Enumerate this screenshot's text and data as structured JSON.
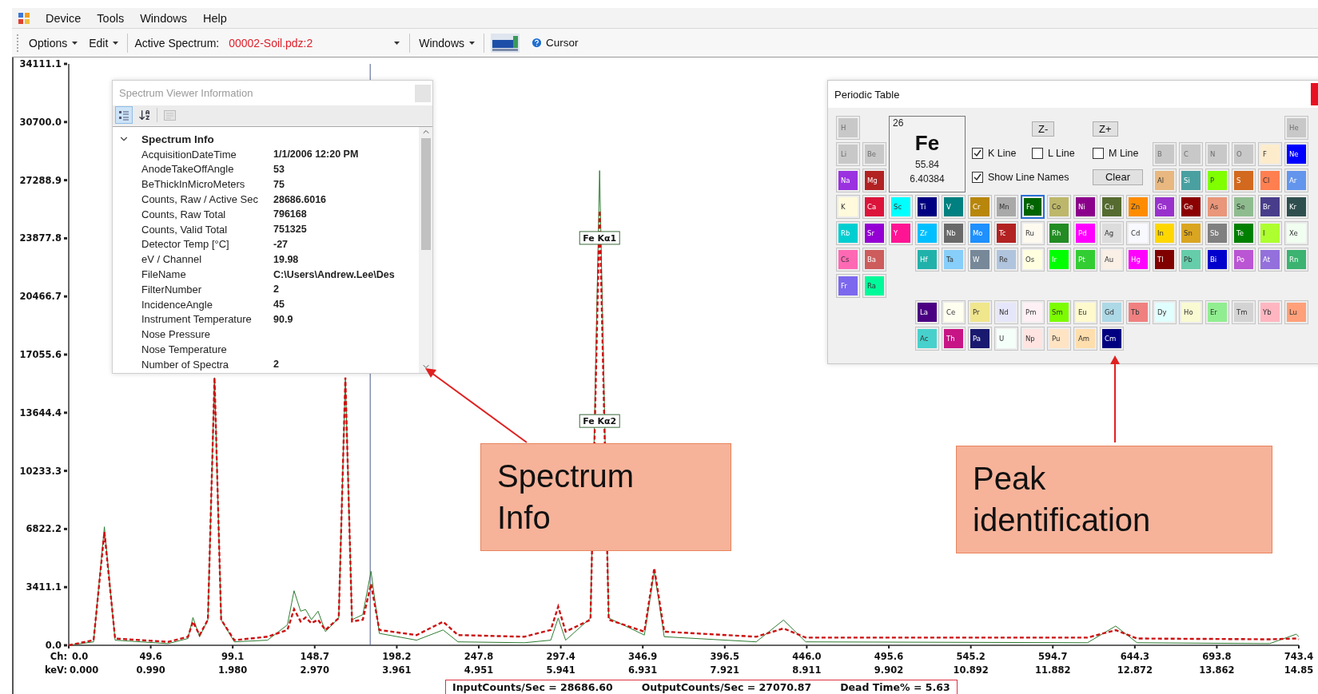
{
  "menu": [
    "Device",
    "Tools",
    "Windows",
    "Help"
  ],
  "toolbar": {
    "menus": [
      "Options",
      "Edit"
    ],
    "active_spectrum": {
      "label": "Active Spectrum:",
      "value": "00002-Soil.pdz:2"
    },
    "windows_menu": "Windows",
    "cursor_button": "Cursor"
  },
  "chart": {
    "channel_axis": {
      "label": "Ch:",
      "ticks": [
        "0.0",
        "49.6",
        "99.1",
        "148.7",
        "198.2",
        "247.8",
        "297.4",
        "346.9",
        "396.5",
        "446.0",
        "495.6",
        "545.2",
        "594.7",
        "644.3",
        "693.8",
        "743.4"
      ]
    },
    "chart_data": {
      "type": "line",
      "xlabel": "keV:",
      "xlim": [
        0,
        14.852
      ],
      "ylim": [
        0,
        34111.1
      ],
      "ref_lines": [
        {
          "axis": "x",
          "value": 3.64,
          "color": "#4a5a8a"
        }
      ],
      "x": [
        0,
        0.3,
        0.43,
        0.56,
        1.2,
        1.44,
        1.5,
        1.58,
        1.68,
        1.76,
        1.84,
        2.0,
        2.4,
        2.64,
        2.72,
        2.8,
        2.86,
        2.93,
        3.01,
        3.1,
        3.26,
        3.34,
        3.42,
        3.55,
        3.65,
        3.75,
        4.2,
        4.52,
        4.7,
        5.5,
        5.82,
        5.91,
        6.0,
        6.3,
        6.41,
        6.52,
        6.95,
        7.07,
        7.19,
        8.3,
        8.63,
        8.9,
        12.3,
        12.64,
        12.9,
        14.5,
        14.82,
        14.852
      ],
      "series": [
        {
          "color": "#2e7d32",
          "line_style": "solid",
          "values": [
            0,
            200,
            6950,
            300,
            100,
            400,
            1630,
            500,
            1500,
            15700,
            1500,
            200,
            300,
            1200,
            3200,
            2000,
            2100,
            1500,
            2000,
            800,
            1600,
            15700,
            1500,
            1800,
            4340,
            700,
            300,
            900,
            200,
            150,
            300,
            1600,
            300,
            1600,
            27850,
            1600,
            600,
            4340,
            500,
            200,
            1480,
            200,
            150,
            1130,
            150,
            100,
            650,
            500
          ]
        },
        {
          "color": "#cc1010",
          "line_style": "dashed",
          "values": [
            0,
            300,
            6650,
            400,
            200,
            500,
            1380,
            600,
            1500,
            15700,
            1500,
            300,
            500,
            900,
            2120,
            1400,
            1630,
            1300,
            1500,
            900,
            1600,
            15700,
            1400,
            1500,
            3600,
            900,
            600,
            1380,
            600,
            500,
            900,
            2270,
            800,
            1500,
            25500,
            1500,
            800,
            4530,
            800,
            500,
            990,
            450,
            450,
            890,
            400,
            350,
            400,
            350
          ]
        }
      ],
      "yticks": [
        {
          "value": 34111.1,
          "label": "34111.1"
        },
        {
          "value": 30700.0,
          "label": "30700.0"
        },
        {
          "value": 27288.9,
          "label": "27288.9"
        },
        {
          "value": 23877.8,
          "label": "23877.8"
        },
        {
          "value": 20466.7,
          "label": "20466.7"
        },
        {
          "value": 17055.6,
          "label": "17055.6"
        },
        {
          "value": 13644.4,
          "label": "13644.4"
        },
        {
          "value": 10233.3,
          "label": "10233.3"
        },
        {
          "value": 6822.2,
          "label": "6822.2"
        },
        {
          "value": 3411.1,
          "label": "3411.1"
        },
        {
          "value": 0,
          "label": "0.0"
        }
      ],
      "xticks": [
        {
          "value": 0,
          "label": "0.000"
        },
        {
          "value": 0.99,
          "label": "0.990"
        },
        {
          "value": 1.98,
          "label": "1.980"
        },
        {
          "value": 2.97,
          "label": "2.970"
        },
        {
          "value": 3.961,
          "label": "3.961"
        },
        {
          "value": 4.951,
          "label": "4.951"
        },
        {
          "value": 5.941,
          "label": "5.941"
        },
        {
          "value": 6.931,
          "label": "6.931"
        },
        {
          "value": 7.921,
          "label": "7.921"
        },
        {
          "value": 8.911,
          "label": "8.911"
        },
        {
          "value": 9.902,
          "label": "9.902"
        },
        {
          "value": 10.892,
          "label": "10.892"
        },
        {
          "value": 11.882,
          "label": "11.882"
        },
        {
          "value": 12.872,
          "label": "12.872"
        },
        {
          "value": 13.862,
          "label": "13.862"
        },
        {
          "value": 14.852,
          "label": "14.85"
        }
      ],
      "annotations": [
        {
          "x": 6.41,
          "y": 23900,
          "text": "Fe Kα1"
        },
        {
          "x": 6.41,
          "y": 13160,
          "text": "Fe Kα2"
        }
      ]
    }
  },
  "status": [
    "InputCounts/Sec = 28686.60",
    "OutputCounts/Sec = 27070.87",
    "Dead Time% = 5.63"
  ],
  "spectrum_panel": {
    "title": "Spectrum Viewer Information",
    "category": {
      "label": "Spectrum Info",
      "expanded": true
    },
    "rows": [
      {
        "name": "AcquisitionDateTime",
        "value": "1/1/2006 12:20 PM"
      },
      {
        "name": "AnodeTakeOffAngle",
        "value": "53"
      },
      {
        "name": "BeThickInMicroMeters",
        "value": "75"
      },
      {
        "name": "Counts, Raw / Active Sec",
        "value": "28686.6016"
      },
      {
        "name": "Counts, Raw Total",
        "value": "796168"
      },
      {
        "name": "Counts, Valid Total",
        "value": "751325"
      },
      {
        "name": "Detector Temp [°C]",
        "value": "-27"
      },
      {
        "name": "eV / Channel",
        "value": "19.98"
      },
      {
        "name": "FileName",
        "value": "C:\\Users\\Andrew.Lee\\Des"
      },
      {
        "name": "FilterNumber",
        "value": "2"
      },
      {
        "name": "IncidenceAngle",
        "value": "45"
      },
      {
        "name": "Instrument Temperature",
        "value": "90.9"
      },
      {
        "name": "Nose Pressure"
      },
      {
        "name": "Nose Temperature"
      },
      {
        "name": "Number of Spectra",
        "value": "2"
      }
    ]
  },
  "periodic_table": {
    "title": "Periodic Table",
    "detail": {
      "number": "26",
      "symbol": "Fe",
      "mass": "55.84",
      "energy": "6.40384"
    },
    "z_buttons": [
      "Z-",
      "Z+"
    ],
    "line_options": [
      {
        "label": "K Line",
        "checked": true
      },
      {
        "label": "L Line",
        "checked": false
      },
      {
        "label": "M Line",
        "checked": false
      }
    ],
    "show_line_names": {
      "label": "Show Line Names",
      "checked": true
    },
    "clear_button": "Clear",
    "rows": [
      [
        {
          "symbol": "H",
          "color": "#c8c8c8",
          "disabled": true,
          "selected": false
        },
        "",
        "",
        "",
        "",
        "",
        "",
        "",
        "",
        "",
        "",
        "",
        "",
        "",
        "",
        "",
        "",
        {
          "symbol": "He",
          "color": "#c8c8c8",
          "disabled": true,
          "selected": false
        }
      ],
      [
        {
          "symbol": "Li",
          "color": "#c8c8c8",
          "disabled": true,
          "selected": false
        },
        {
          "symbol": "Be",
          "color": "#c8c8c8",
          "disabled": true,
          "selected": false
        },
        "",
        "",
        "",
        "",
        "",
        "",
        "",
        "",
        "",
        "",
        {
          "symbol": "B",
          "color": "#c8c8c8",
          "disabled": true,
          "selected": false
        },
        {
          "symbol": "C",
          "color": "#c8c8c8",
          "disabled": true,
          "selected": false
        },
        {
          "symbol": "N",
          "color": "#c8c8c8",
          "disabled": true,
          "selected": false
        },
        {
          "symbol": "O",
          "color": "#c8c8c8",
          "disabled": true,
          "selected": false
        },
        {
          "symbol": "F",
          "color": "#fdeccc",
          "disabled": false,
          "selected": false
        },
        {
          "symbol": "Ne",
          "color": "#0000ff",
          "disabled": false,
          "selected": false
        }
      ],
      [
        {
          "symbol": "Na",
          "color": "#9a32e0",
          "disabled": false,
          "selected": false
        },
        {
          "symbol": "Mg",
          "color": "#b22222",
          "disabled": false,
          "selected": false
        },
        "",
        "",
        "",
        "",
        "",
        "",
        "",
        "",
        "",
        "",
        {
          "symbol": "Al",
          "color": "#e8b880",
          "disabled": false,
          "selected": false
        },
        {
          "symbol": "Si",
          "color": "#4aa0a0",
          "disabled": false,
          "selected": false
        },
        {
          "symbol": "P",
          "color": "#7fff00",
          "disabled": false,
          "selected": false
        },
        {
          "symbol": "S",
          "color": "#d2691e",
          "disabled": false,
          "selected": false
        },
        {
          "symbol": "Cl",
          "color": "#ff7f50",
          "disabled": false,
          "selected": false
        },
        {
          "symbol": "Ar",
          "color": "#6495ed",
          "disabled": false,
          "selected": false
        }
      ],
      [
        {
          "symbol": "K",
          "color": "#fffadc",
          "disabled": false,
          "selected": false
        },
        {
          "symbol": "Ca",
          "color": "#dc143c",
          "disabled": false,
          "selected": false
        },
        {
          "symbol": "Sc",
          "color": "#00ffff",
          "disabled": false,
          "selected": false
        },
        {
          "symbol": "Ti",
          "color": "#000080",
          "disabled": false,
          "selected": false
        },
        {
          "symbol": "V",
          "color": "#008080",
          "disabled": false,
          "selected": false
        },
        {
          "symbol": "Cr",
          "color": "#b8860b",
          "disabled": false,
          "selected": false
        },
        {
          "symbol": "Mn",
          "color": "#a9a9a9",
          "disabled": false,
          "selected": false
        },
        {
          "symbol": "Fe",
          "color": "#006400",
          "disabled": false,
          "selected": true
        },
        {
          "symbol": "Co",
          "color": "#bdb76b",
          "disabled": false,
          "selected": false
        },
        {
          "symbol": "Ni",
          "color": "#8b008b",
          "disabled": false,
          "selected": false
        },
        {
          "symbol": "Cu",
          "color": "#556b2f",
          "disabled": false,
          "selected": false
        },
        {
          "symbol": "Zn",
          "color": "#ff8c00",
          "disabled": false,
          "selected": false
        },
        {
          "symbol": "Ga",
          "color": "#9932cc",
          "disabled": false,
          "selected": false
        },
        {
          "symbol": "Ge",
          "color": "#8b0000",
          "disabled": false,
          "selected": false
        },
        {
          "symbol": "As",
          "color": "#e9967a",
          "disabled": false,
          "selected": false
        },
        {
          "symbol": "Se",
          "color": "#8fbc8f",
          "disabled": false,
          "selected": false
        },
        {
          "symbol": "Br",
          "color": "#483d8b",
          "disabled": false,
          "selected": false
        },
        {
          "symbol": "Kr",
          "color": "#2f4f4f",
          "disabled": false,
          "selected": false
        }
      ],
      [
        {
          "symbol": "Rb",
          "color": "#00ced1",
          "disabled": false,
          "selected": false
        },
        {
          "symbol": "Sr",
          "color": "#9400d3",
          "disabled": false,
          "selected": false
        },
        {
          "symbol": "Y",
          "color": "#ff1493",
          "disabled": false,
          "selected": false
        },
        {
          "symbol": "Zr",
          "color": "#00bfff",
          "disabled": false,
          "selected": false
        },
        {
          "symbol": "Nb",
          "color": "#696969",
          "disabled": false,
          "selected": false
        },
        {
          "symbol": "Mo",
          "color": "#1e90ff",
          "disabled": false,
          "selected": false
        },
        {
          "symbol": "Tc",
          "color": "#b22222",
          "disabled": false,
          "selected": false
        },
        {
          "symbol": "Ru",
          "color": "#fffaf0",
          "disabled": false,
          "selected": false
        },
        {
          "symbol": "Rh",
          "color": "#228b22",
          "disabled": false,
          "selected": false
        },
        {
          "symbol": "Pd",
          "color": "#ff00ff",
          "disabled": false,
          "selected": false
        },
        {
          "symbol": "Ag",
          "color": "#dcdcdc",
          "disabled": false,
          "selected": false
        },
        {
          "symbol": "Cd",
          "color": "#f8f8ff",
          "disabled": false,
          "selected": false
        },
        {
          "symbol": "In",
          "color": "#ffd700",
          "disabled": false,
          "selected": false
        },
        {
          "symbol": "Sn",
          "color": "#daa520",
          "disabled": false,
          "selected": false
        },
        {
          "symbol": "Sb",
          "color": "#808080",
          "disabled": false,
          "selected": false
        },
        {
          "symbol": "Te",
          "color": "#008000",
          "disabled": false,
          "selected": false
        },
        {
          "symbol": "I",
          "color": "#adff2f",
          "disabled": false,
          "selected": false
        },
        {
          "symbol": "Xe",
          "color": "#f0fff0",
          "disabled": false,
          "selected": false
        }
      ],
      [
        {
          "symbol": "Cs",
          "color": "#ff69b4",
          "disabled": false,
          "selected": false
        },
        {
          "symbol": "Ba",
          "color": "#cd5c5c",
          "disabled": false,
          "selected": false
        },
        "",
        {
          "symbol": "Hf",
          "color": "#20b2aa",
          "disabled": false,
          "selected": false
        },
        {
          "symbol": "Ta",
          "color": "#87cefa",
          "disabled": false,
          "selected": false
        },
        {
          "symbol": "W",
          "color": "#778899",
          "disabled": false,
          "selected": false
        },
        {
          "symbol": "Re",
          "color": "#b0c4de",
          "disabled": false,
          "selected": false
        },
        {
          "symbol": "Os",
          "color": "#ffffe0",
          "disabled": false,
          "selected": false
        },
        {
          "symbol": "Ir",
          "color": "#00ff00",
          "disabled": false,
          "selected": false
        },
        {
          "symbol": "Pt",
          "color": "#32cd32",
          "disabled": false,
          "selected": false
        },
        {
          "symbol": "Au",
          "color": "#faf0e6",
          "disabled": false,
          "selected": false
        },
        {
          "symbol": "Hg",
          "color": "#ff00ff",
          "disabled": false,
          "selected": false
        },
        {
          "symbol": "Tl",
          "color": "#800000",
          "disabled": false,
          "selected": false
        },
        {
          "symbol": "Pb",
          "color": "#66cdaa",
          "disabled": false,
          "selected": false
        },
        {
          "symbol": "Bi",
          "color": "#0000cd",
          "disabled": false,
          "selected": false
        },
        {
          "symbol": "Po",
          "color": "#ba55d3",
          "disabled": false,
          "selected": false
        },
        {
          "symbol": "At",
          "color": "#9370db",
          "disabled": false,
          "selected": false
        },
        {
          "symbol": "Rn",
          "color": "#3cb371",
          "disabled": false,
          "selected": false
        }
      ],
      [
        {
          "symbol": "Fr",
          "color": "#7b68ee",
          "disabled": false,
          "selected": false
        },
        {
          "symbol": "Ra",
          "color": "#00fa9a",
          "disabled": false,
          "selected": false
        }
      ],
      [
        "",
        "",
        "",
        {
          "symbol": "La",
          "color": "#4b0082",
          "disabled": false,
          "selected": false
        },
        {
          "symbol": "Ce",
          "color": "#fffff0",
          "disabled": false,
          "selected": false
        },
        {
          "symbol": "Pr",
          "color": "#f0e68c",
          "disabled": false,
          "selected": false
        },
        {
          "symbol": "Nd",
          "color": "#e6e6fa",
          "disabled": false,
          "selected": false
        },
        {
          "symbol": "Pm",
          "color": "#fff0f5",
          "disabled": false,
          "selected": false
        },
        {
          "symbol": "Sm",
          "color": "#7cfc00",
          "disabled": false,
          "selected": false
        },
        {
          "symbol": "Eu",
          "color": "#fffacd",
          "disabled": false,
          "selected": false
        },
        {
          "symbol": "Gd",
          "color": "#add8e6",
          "disabled": false,
          "selected": false
        },
        {
          "symbol": "Tb",
          "color": "#f08080",
          "disabled": false,
          "selected": false
        },
        {
          "symbol": "Dy",
          "color": "#e0ffff",
          "disabled": false,
          "selected": false
        },
        {
          "symbol": "Ho",
          "color": "#fafad2",
          "disabled": false,
          "selected": false
        },
        {
          "symbol": "Er",
          "color": "#90ee90",
          "disabled": false,
          "selected": false
        },
        {
          "symbol": "Tm",
          "color": "#d3d3d3",
          "disabled": false,
          "selected": false
        },
        {
          "symbol": "Yb",
          "color": "#ffb6c1",
          "disabled": false,
          "selected": false
        },
        {
          "symbol": "Lu",
          "color": "#ffa07a",
          "disabled": false,
          "selected": false
        }
      ],
      [
        "",
        "",
        "",
        {
          "symbol": "Ac",
          "color": "#48d1cc",
          "disabled": false,
          "selected": false
        },
        {
          "symbol": "Th",
          "color": "#c71585",
          "disabled": false,
          "selected": false
        },
        {
          "symbol": "Pa",
          "color": "#191970",
          "disabled": false,
          "selected": false
        },
        {
          "symbol": "U",
          "color": "#f5fffa",
          "disabled": false,
          "selected": false
        },
        {
          "symbol": "Np",
          "color": "#ffe4e1",
          "disabled": false,
          "selected": false
        },
        {
          "symbol": "Pu",
          "color": "#ffe4c4",
          "disabled": false,
          "selected": false
        },
        {
          "symbol": "Am",
          "color": "#ffdead",
          "disabled": false,
          "selected": false
        },
        {
          "symbol": "Cm",
          "color": "#000080",
          "disabled": false,
          "selected": false
        }
      ]
    ]
  },
  "callouts": [
    "Spectrum Info",
    "Peak identification"
  ]
}
